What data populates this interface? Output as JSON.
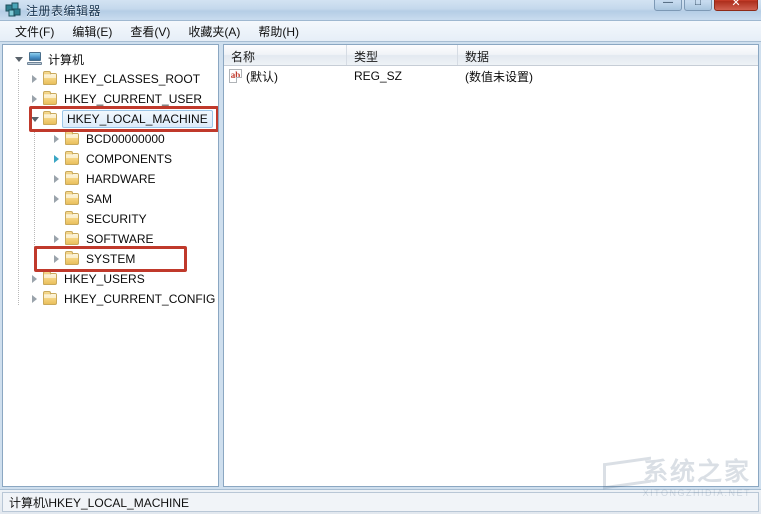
{
  "window": {
    "title": "注册表编辑器",
    "icon": "registry-editor-icon",
    "minimize_glyph": "—",
    "maximize_glyph": "□",
    "close_glyph": "✕"
  },
  "menubar": {
    "items": [
      {
        "label": "文件(F)",
        "name": "menu-file"
      },
      {
        "label": "编辑(E)",
        "name": "menu-edit"
      },
      {
        "label": "查看(V)",
        "name": "menu-view"
      },
      {
        "label": "收藏夹(A)",
        "name": "menu-favorites"
      },
      {
        "label": "帮助(H)",
        "name": "menu-help"
      }
    ]
  },
  "tree": {
    "nodes": [
      {
        "label": "计算机",
        "depth": 0,
        "icon": "computer-icon",
        "state": "open",
        "selected": false
      },
      {
        "label": "HKEY_CLASSES_ROOT",
        "depth": 1,
        "icon": "folder-icon",
        "state": "collapsed",
        "selected": false
      },
      {
        "label": "HKEY_CURRENT_USER",
        "depth": 1,
        "icon": "folder-icon",
        "state": "collapsed",
        "selected": false
      },
      {
        "label": "HKEY_LOCAL_MACHINE",
        "depth": 1,
        "icon": "folder-icon",
        "state": "open",
        "selected": true
      },
      {
        "label": "BCD00000000",
        "depth": 2,
        "icon": "folder-icon",
        "state": "collapsed",
        "selected": false
      },
      {
        "label": "COMPONENTS",
        "depth": 2,
        "icon": "folder-icon",
        "state": "collapsed-teal",
        "selected": false
      },
      {
        "label": "HARDWARE",
        "depth": 2,
        "icon": "folder-icon",
        "state": "collapsed",
        "selected": false
      },
      {
        "label": "SAM",
        "depth": 2,
        "icon": "folder-icon",
        "state": "collapsed",
        "selected": false
      },
      {
        "label": "SECURITY",
        "depth": 2,
        "icon": "folder-icon",
        "state": "leaf",
        "selected": false
      },
      {
        "label": "SOFTWARE",
        "depth": 2,
        "icon": "folder-icon",
        "state": "collapsed",
        "selected": false
      },
      {
        "label": "SYSTEM",
        "depth": 2,
        "icon": "folder-icon",
        "state": "collapsed",
        "selected": false
      },
      {
        "label": "HKEY_USERS",
        "depth": 1,
        "icon": "folder-icon",
        "state": "collapsed",
        "selected": false
      },
      {
        "label": "HKEY_CURRENT_CONFIG",
        "depth": 1,
        "icon": "folder-icon",
        "state": "collapsed",
        "selected": false
      }
    ],
    "annotations": [
      {
        "name": "highlight-box-hkey-local-machine",
        "target": "HKEY_LOCAL_MACHINE",
        "color": "#c0392b"
      },
      {
        "name": "highlight-box-system",
        "target": "SYSTEM",
        "color": "#c0392b"
      }
    ]
  },
  "list": {
    "columns": [
      {
        "label": "名称",
        "name": "column-name"
      },
      {
        "label": "类型",
        "name": "column-type"
      },
      {
        "label": "数据",
        "name": "column-data"
      }
    ],
    "rows": [
      {
        "icon": "string-value-icon",
        "name": "(默认)",
        "type": "REG_SZ",
        "data": "(数值未设置)"
      }
    ]
  },
  "statusbar": {
    "path": "计算机\\HKEY_LOCAL_MACHINE"
  },
  "watermark": {
    "cn": "系统之家",
    "en": "XITONGZHIDIA.NET"
  }
}
